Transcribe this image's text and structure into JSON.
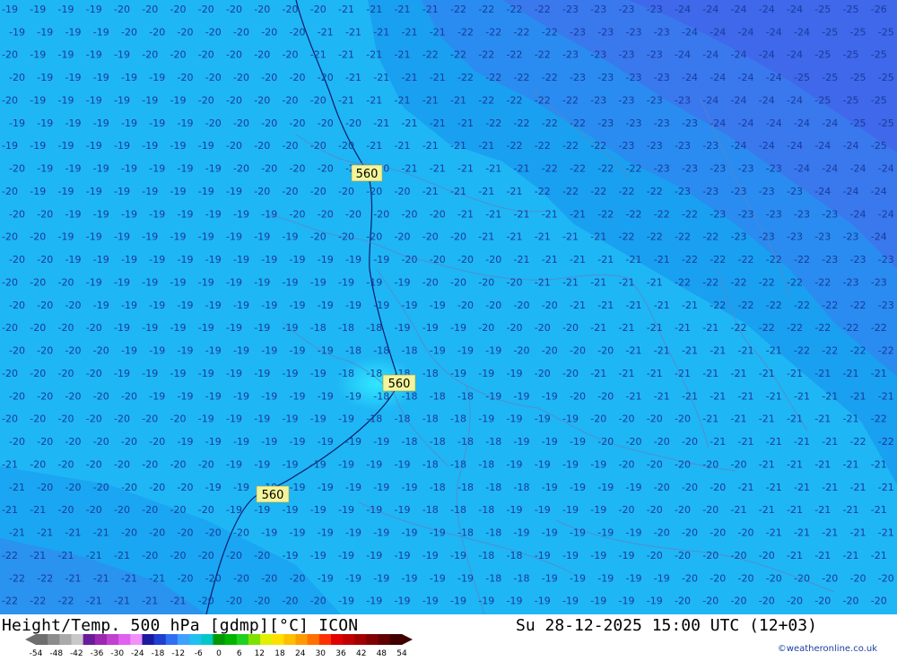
{
  "footer": {
    "title": "Height/Temp. 500 hPa [gdmp][°C] ICON",
    "datetime": "Su 28-12-2025 15:00 UTC (12+03)",
    "credit": "©weatheronline.co.uk"
  },
  "legend": {
    "ticks": [
      "-54",
      "-48",
      "-42",
      "-36",
      "-30",
      "-24",
      "-18",
      "-12",
      "-6",
      "0",
      "6",
      "12",
      "18",
      "24",
      "30",
      "36",
      "42",
      "48",
      "54"
    ],
    "colors": [
      "#6e6e6e",
      "#8c8c8c",
      "#aaaaaa",
      "#c8c8c8",
      "#6a1b9a",
      "#9c27b0",
      "#c040d0",
      "#e060f0",
      "#f090f8",
      "#1a1aa0",
      "#2040d0",
      "#3070f0",
      "#40a0ff",
      "#20c0f0",
      "#00c8c8",
      "#009a00",
      "#00b400",
      "#20d020",
      "#80e000",
      "#e0f000",
      "#ffe000",
      "#ffc000",
      "#ff9a00",
      "#ff7000",
      "#ff3000",
      "#e00000",
      "#c00000",
      "#a00000",
      "#800000",
      "#600000",
      "#400000"
    ]
  },
  "map": {
    "background_color": "#1fb6f5",
    "contour_value": "560",
    "contour_badges": [
      "560",
      "560",
      "560"
    ],
    "temperature_grid": {
      "rows": 27,
      "cols": 32,
      "values": [
        [
          -19,
          -19,
          -19,
          -19,
          -20,
          -20,
          -20,
          -20,
          -20,
          -20,
          -20,
          -20,
          -21,
          -21,
          -21,
          -21,
          -22,
          -22,
          -22,
          -22,
          -23,
          -23,
          -23,
          -23,
          -24,
          -24,
          -24,
          -24,
          -24,
          -25,
          -25,
          -26
        ],
        [
          -19,
          -19,
          -19,
          -19,
          -20,
          -20,
          -20,
          -20,
          -20,
          -20,
          -20,
          -21,
          -21,
          -21,
          -21,
          -21,
          -22,
          -22,
          -22,
          -22,
          -23,
          -23,
          -23,
          -23,
          -24,
          -24,
          -24,
          -24,
          -24,
          -25,
          -25,
          -25
        ],
        [
          -20,
          -19,
          -19,
          -19,
          -19,
          -20,
          -20,
          -20,
          -20,
          -20,
          -20,
          -21,
          -21,
          -21,
          -21,
          -22,
          -22,
          -22,
          -22,
          -22,
          -23,
          -23,
          -23,
          -23,
          -24,
          -24,
          -24,
          -24,
          -24,
          -25,
          -25,
          -25
        ],
        [
          -20,
          -19,
          -19,
          -19,
          -19,
          -19,
          -20,
          -20,
          -20,
          -20,
          -20,
          -20,
          -21,
          -21,
          -21,
          -21,
          -22,
          -22,
          -22,
          -22,
          -23,
          -23,
          -23,
          -23,
          -24,
          -24,
          -24,
          -24,
          -25,
          -25,
          -25,
          -25
        ],
        [
          -20,
          -19,
          -19,
          -19,
          -19,
          -19,
          -19,
          -20,
          -20,
          -20,
          -20,
          -20,
          -21,
          -21,
          -21,
          -21,
          -21,
          -22,
          -22,
          -22,
          -22,
          -23,
          -23,
          -23,
          -23,
          -24,
          -24,
          -24,
          -24,
          -25,
          -25,
          -25
        ],
        [
          -19,
          -19,
          -19,
          -19,
          -19,
          -19,
          -19,
          -20,
          -20,
          -20,
          -20,
          -20,
          -20,
          -21,
          -21,
          -21,
          -21,
          -22,
          -22,
          -22,
          -22,
          -23,
          -23,
          -23,
          -23,
          -24,
          -24,
          -24,
          -24,
          -24,
          -25,
          -25
        ],
        [
          -19,
          -19,
          -19,
          -19,
          -19,
          -19,
          -19,
          -19,
          -20,
          -20,
          -20,
          -20,
          -20,
          -21,
          -21,
          -21,
          -21,
          -21,
          -22,
          -22,
          -22,
          -22,
          -23,
          -23,
          -23,
          -23,
          -24,
          -24,
          -24,
          -24,
          -24,
          -25
        ],
        [
          -20,
          -19,
          -19,
          -19,
          -19,
          -19,
          -19,
          -19,
          -20,
          -20,
          -20,
          -20,
          -20,
          -20,
          -21,
          -21,
          -21,
          -21,
          -21,
          -22,
          -22,
          -22,
          -22,
          -23,
          -23,
          -23,
          -23,
          -23,
          -24,
          -24,
          -24,
          -24
        ],
        [
          -20,
          -19,
          -19,
          -19,
          -19,
          -19,
          -19,
          -19,
          -19,
          -20,
          -20,
          -20,
          -20,
          -20,
          -20,
          -21,
          -21,
          -21,
          -21,
          -22,
          -22,
          -22,
          -22,
          -22,
          -23,
          -23,
          -23,
          -23,
          -23,
          -24,
          -24,
          -24
        ],
        [
          -20,
          -20,
          -19,
          -19,
          -19,
          -19,
          -19,
          -19,
          -19,
          -19,
          -20,
          -20,
          -20,
          -20,
          -20,
          -20,
          -21,
          -21,
          -21,
          -21,
          -21,
          -22,
          -22,
          -22,
          -22,
          -23,
          -23,
          -23,
          -23,
          -23,
          -24,
          -24
        ],
        [
          -20,
          -20,
          -19,
          -19,
          -19,
          -19,
          -19,
          -19,
          -19,
          -19,
          -19,
          -20,
          -20,
          -20,
          -20,
          -20,
          -20,
          -21,
          -21,
          -21,
          -21,
          -21,
          -22,
          -22,
          -22,
          -22,
          -23,
          -23,
          -23,
          -23,
          -23,
          -24
        ],
        [
          -20,
          -20,
          -19,
          -19,
          -19,
          -19,
          -19,
          -19,
          -19,
          -19,
          -19,
          -19,
          -19,
          -19,
          -20,
          -20,
          -20,
          -20,
          -21,
          -21,
          -21,
          -21,
          -21,
          -21,
          -22,
          -22,
          -22,
          -22,
          -22,
          -23,
          -23,
          -23
        ],
        [
          -20,
          -20,
          -20,
          -19,
          -19,
          -19,
          -19,
          -19,
          -19,
          -19,
          -19,
          -19,
          -19,
          -19,
          -19,
          -20,
          -20,
          -20,
          -20,
          -21,
          -21,
          -21,
          -21,
          -21,
          -22,
          -22,
          -22,
          -22,
          -22,
          -22,
          -23,
          -23
        ],
        [
          -20,
          -20,
          -20,
          -19,
          -19,
          -19,
          -19,
          -19,
          -19,
          -19,
          -19,
          -19,
          -19,
          -19,
          -19,
          -19,
          -20,
          -20,
          -20,
          -20,
          -21,
          -21,
          -21,
          -21,
          -21,
          -22,
          -22,
          -22,
          -22,
          -22,
          -22,
          -23
        ],
        [
          -20,
          -20,
          -20,
          -20,
          -19,
          -19,
          -19,
          -19,
          -19,
          -19,
          -19,
          -18,
          -18,
          -18,
          -19,
          -19,
          -19,
          -20,
          -20,
          -20,
          -20,
          -21,
          -21,
          -21,
          -21,
          -21,
          -22,
          -22,
          -22,
          -22,
          -22,
          -22
        ],
        [
          -20,
          -20,
          -20,
          -20,
          -19,
          -19,
          -19,
          -19,
          -19,
          -19,
          -19,
          -19,
          -18,
          -18,
          -18,
          -19,
          -19,
          -19,
          -20,
          -20,
          -20,
          -20,
          -21,
          -21,
          -21,
          -21,
          -21,
          -21,
          -22,
          -22,
          -22,
          -22
        ],
        [
          -20,
          -20,
          -20,
          -20,
          -19,
          -19,
          -19,
          -19,
          -19,
          -19,
          -19,
          -19,
          -18,
          -18,
          -18,
          -18,
          -19,
          -19,
          -19,
          -20,
          -20,
          -21,
          -21,
          -21,
          -21,
          -21,
          -21,
          -21,
          -21,
          -21,
          -21,
          -21
        ],
        [
          -20,
          -20,
          -20,
          -20,
          -20,
          -19,
          -19,
          -19,
          -19,
          -19,
          -19,
          -19,
          -19,
          -18,
          -18,
          -18,
          -18,
          -19,
          -19,
          -19,
          -20,
          -20,
          -21,
          -21,
          -21,
          -21,
          -21,
          -21,
          -21,
          -21,
          -21,
          -21
        ],
        [
          -20,
          -20,
          -20,
          -20,
          -20,
          -20,
          -20,
          -19,
          -19,
          -19,
          -19,
          -19,
          -19,
          -18,
          -18,
          -18,
          -18,
          -19,
          -19,
          -19,
          -19,
          -20,
          -20,
          -20,
          -20,
          -21,
          -21,
          -21,
          -21,
          -21,
          -21,
          -22
        ],
        [
          -20,
          -20,
          -20,
          -20,
          -20,
          -20,
          -19,
          -19,
          -19,
          -19,
          -19,
          -19,
          -19,
          -19,
          -18,
          -18,
          -18,
          -18,
          -19,
          -19,
          -19,
          -20,
          -20,
          -20,
          -20,
          -21,
          -21,
          -21,
          -21,
          -21,
          -22,
          -22
        ],
        [
          -21,
          -20,
          -20,
          -20,
          -20,
          -20,
          -20,
          -20,
          -19,
          -19,
          -19,
          -19,
          -19,
          -19,
          -19,
          -18,
          -18,
          -18,
          -19,
          -19,
          -19,
          -19,
          -20,
          -20,
          -20,
          -20,
          -20,
          -21,
          -21,
          -21,
          -21,
          -21
        ],
        [
          -21,
          -20,
          -20,
          -20,
          -20,
          -20,
          -20,
          -19,
          -19,
          -19,
          -19,
          -19,
          -19,
          -19,
          -19,
          -18,
          -18,
          -18,
          -18,
          -19,
          -19,
          -19,
          -19,
          -20,
          -20,
          -20,
          -21,
          -21,
          -21,
          -21,
          -21,
          -21
        ],
        [
          -21,
          -21,
          -20,
          -20,
          -20,
          -20,
          -20,
          -20,
          -19,
          -19,
          -19,
          -19,
          -19,
          -19,
          -19,
          -18,
          -18,
          -18,
          -19,
          -19,
          -19,
          -19,
          -20,
          -20,
          -20,
          -20,
          -21,
          -21,
          -21,
          -21,
          -21,
          -21
        ],
        [
          -21,
          -21,
          -21,
          -21,
          -20,
          -20,
          -20,
          -20,
          -20,
          -19,
          -19,
          -19,
          -19,
          -19,
          -19,
          -19,
          -18,
          -18,
          -19,
          -19,
          -19,
          -19,
          -19,
          -20,
          -20,
          -20,
          -20,
          -21,
          -21,
          -21,
          -21,
          -21
        ],
        [
          -22,
          -21,
          -21,
          -21,
          -21,
          -20,
          -20,
          -20,
          -20,
          -20,
          -19,
          -19,
          -19,
          -19,
          -19,
          -19,
          -19,
          -18,
          -18,
          -19,
          -19,
          -19,
          -19,
          -20,
          -20,
          -20,
          -20,
          -20,
          -21,
          -21,
          -21,
          -21
        ],
        [
          -22,
          -22,
          -21,
          -21,
          -21,
          -21,
          -20,
          -20,
          -20,
          -20,
          -20,
          -19,
          -19,
          -19,
          -19,
          -19,
          -19,
          -18,
          -18,
          -19,
          -19,
          -19,
          -19,
          -19,
          -20,
          -20,
          -20,
          -20,
          -20,
          -20,
          -20,
          -20
        ],
        [
          -22,
          -22,
          -22,
          -21,
          -21,
          -21,
          -21,
          -20,
          -20,
          -20,
          -20,
          -20,
          -19,
          -19,
          -19,
          -19,
          -19,
          -19,
          -19,
          -19,
          -19,
          -19,
          -19,
          -19,
          -20,
          -20,
          -20,
          -20,
          -20,
          -20,
          -20,
          -20
        ]
      ]
    }
  }
}
